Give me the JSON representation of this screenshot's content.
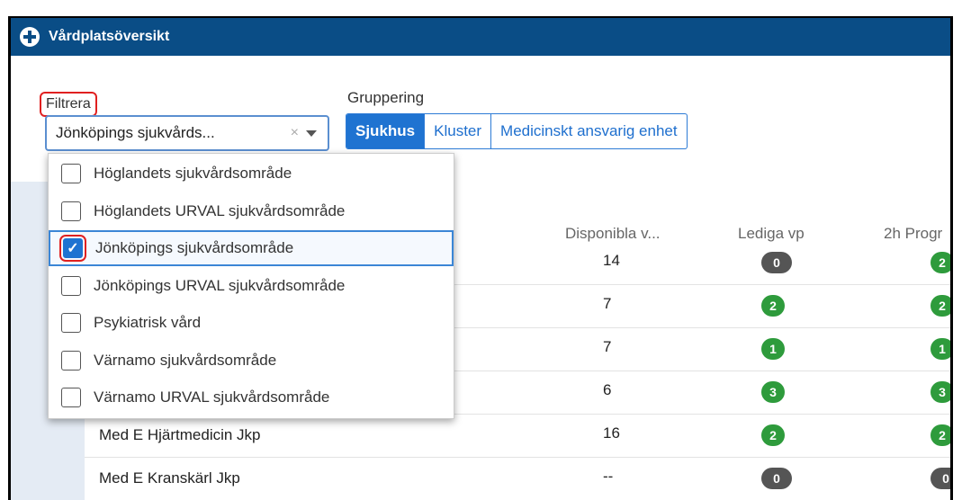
{
  "window": {
    "title": "Vårdplatsöversikt"
  },
  "filter": {
    "label": "Filtrera",
    "selected_value": "Jönköpings sjukvårds...",
    "clear_glyph": "×",
    "options": [
      {
        "label": "Höglandets sjukvårdsområde",
        "checked": false
      },
      {
        "label": "Höglandets URVAL sjukvårdsområde",
        "checked": false
      },
      {
        "label": "Jönköpings sjukvårdsområde",
        "checked": true
      },
      {
        "label": "Jönköpings URVAL sjukvårdsområde",
        "checked": false
      },
      {
        "label": "Psykiatrisk vård",
        "checked": false
      },
      {
        "label": "Värnamo sjukvårdsområde",
        "checked": false
      },
      {
        "label": "Värnamo URVAL sjukvårdsområde",
        "checked": false
      }
    ]
  },
  "grouping": {
    "label": "Gruppering",
    "options": [
      "Sjukhus",
      "Kluster",
      "Medicinskt ansvarig enhet"
    ],
    "active": "Sjukhus"
  },
  "table": {
    "headers": {
      "disp": "Disponibla v...",
      "lediga": "Lediga vp",
      "prog": "2h Progr"
    },
    "rows": [
      {
        "name": "",
        "disp": "14",
        "lediga": "0",
        "prog": "2"
      },
      {
        "name": "",
        "disp": "7",
        "lediga": "2",
        "prog": "2"
      },
      {
        "name": "",
        "disp": "7",
        "lediga": "1",
        "prog": "1"
      },
      {
        "name": "",
        "disp": "6",
        "lediga": "3",
        "prog": "3"
      },
      {
        "name": "Med E Hjärtmedicin Jkp",
        "disp": "16",
        "lediga": "2",
        "prog": "2"
      },
      {
        "name": "Med E Kranskärl Jkp",
        "disp": "--",
        "lediga": "0",
        "prog": "0"
      }
    ]
  },
  "colors": {
    "green": "#2e9b3c",
    "gray": "#555555",
    "accent": "#1f73d1",
    "titlebar": "#0a4d86"
  }
}
